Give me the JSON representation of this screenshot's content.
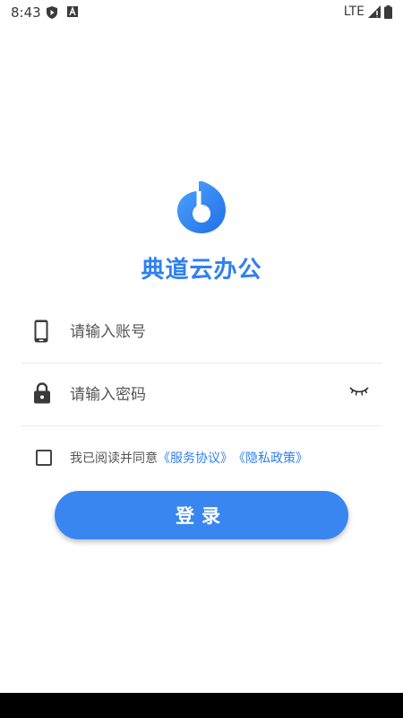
{
  "status_bar": {
    "time": "8:43",
    "network": "LTE",
    "icons": [
      "shield-play-icon",
      "font-a-icon",
      "signal-icon",
      "battery-icon"
    ]
  },
  "app": {
    "title": "典道云办公",
    "logo_icon": "music-note-logo-icon"
  },
  "login_form": {
    "account": {
      "placeholder": "请输入账号",
      "value": "",
      "icon": "phone-icon"
    },
    "password": {
      "placeholder": "请输入密码",
      "value": "",
      "icon": "lock-icon",
      "toggle_icon": "eye-closed-icon"
    }
  },
  "agreement": {
    "checked": false,
    "prefix": "我已阅读并同意",
    "service_link": "《服务协议》",
    "privacy_link": "《隐私政策》"
  },
  "actions": {
    "login_label": "登录"
  },
  "colors": {
    "accent": "#2f80f0",
    "button": "#3a86f0"
  }
}
